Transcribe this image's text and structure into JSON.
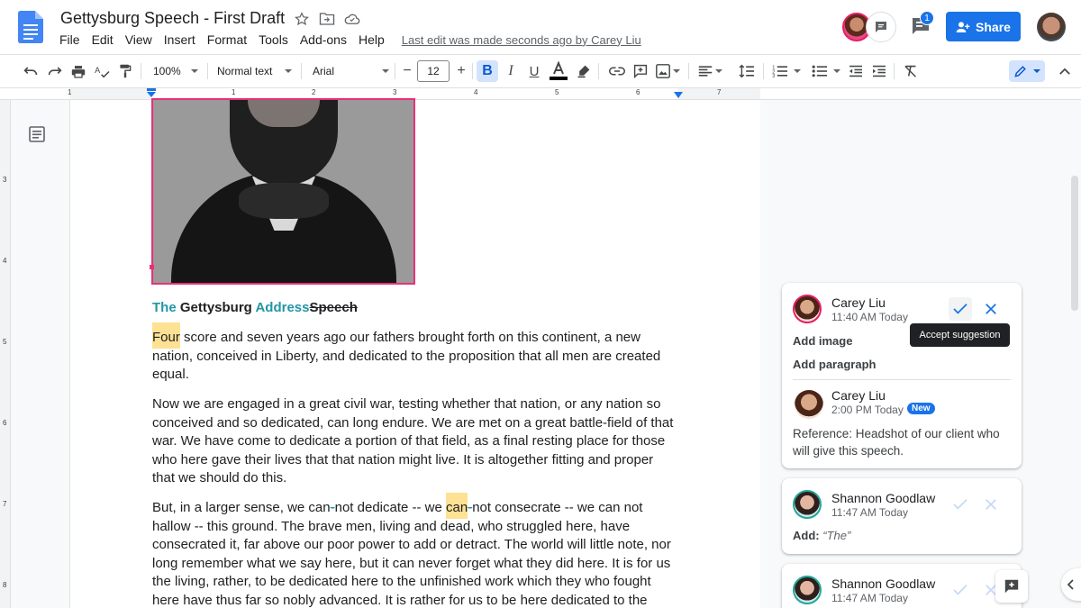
{
  "header": {
    "doc_title": "Gettysburg Speech - First Draft",
    "menus": [
      "File",
      "Edit",
      "View",
      "Insert",
      "Format",
      "Tools",
      "Add-ons",
      "Help"
    ],
    "last_edit": "Last edit was made seconds ago by Carey Liu",
    "comment_count": "1",
    "share_label": "Share"
  },
  "toolbar": {
    "zoom": "100%",
    "style": "Normal text",
    "font": "Arial",
    "font_size": "12",
    "bold": "B",
    "italic": "I",
    "underline": "U"
  },
  "ruler": {
    "h_numbers": [
      "1",
      "1",
      "2",
      "3",
      "4",
      "5",
      "6",
      "7"
    ],
    "v_numbers": [
      "3",
      "4",
      "5",
      "6",
      "7",
      "8"
    ]
  },
  "document": {
    "heading": {
      "ins1": "The",
      "normal": " Gettysburg ",
      "ins2": "Address",
      "del": "Speech"
    },
    "para1": {
      "hl": "Four",
      "l1": " score and seven years ago our fathers brought forth on this continent, a new",
      "l2": "nation, conceived in Liberty, and dedicated to the proposition that all men are created",
      "l3": "equal."
    },
    "para2": [
      "Now we are engaged in a great civil war, testing whether that nation, or any nation so",
      "conceived and so dedicated, can long endure. We are met on a great battle-field of that",
      "war. We have come to dedicate a portion of that field, as a final resting place for those",
      "who here gave their lives that that nation might live. It is altogether fitting and proper",
      "that we should do this."
    ],
    "para3": {
      "l1a": "But, in a larger sense, we can",
      "l1b": "not dedicate -- we ",
      "l1hl": "can",
      "l1c": "not consecrate -- we can not",
      "rest": [
        "hallow -- this ground. The brave men, living and dead, who struggled here, have",
        "consecrated it, far above our poor power to add or detract. The world will little note, nor",
        "long remember what we say here, but it can never forget what they did here. It is for us",
        "the living, rather, to be dedicated here to the unfinished work which they who fought",
        "here have thus far so nobly advanced. It is rather for us to be here dedicated to the"
      ]
    }
  },
  "comments": [
    {
      "author": "Carey Liu",
      "time": "11:40 AM Today",
      "items": [
        "Add image",
        "Add paragraph"
      ],
      "tooltip": "Accept suggestion"
    },
    {
      "author": "Carey Liu",
      "time": "2:00 PM Today",
      "badge": "New",
      "text": "Reference: Headshot of our client who will give this speech."
    },
    {
      "author": "Shannon Goodlaw",
      "time": "11:47 AM Today",
      "label": "Add:",
      "value": "“The”"
    },
    {
      "author": "Shannon Goodlaw",
      "time": "11:47 AM Today"
    }
  ],
  "colors": {
    "accent": "#1a73e8",
    "suggestion": "#2196a6",
    "highlight": "#fde293",
    "image_border": "#e8307a"
  }
}
